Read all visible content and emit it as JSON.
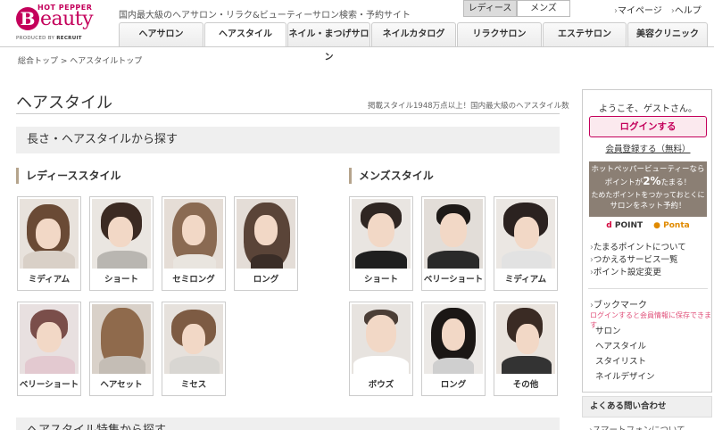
{
  "header": {
    "logo_top": "HOT PEPPER",
    "logo_b": "B",
    "logo_rest": "eauty",
    "logo_produced": "PRODUCED BY",
    "logo_recruit": "RECRUIT",
    "tagline": "国内最大級のヘアサロン・リラク&ビューティーサロン検索・予約サイト",
    "gender_tabs": [
      "レディース",
      "メンズ"
    ],
    "links": [
      "マイページ",
      "ヘルプ"
    ]
  },
  "nav": [
    "ヘアサロン",
    "ヘアスタイル",
    "ネイル・まつげサロン",
    "ネイルカタログ",
    "リラクサロン",
    "エステサロン",
    "美容クリニック"
  ],
  "breadcrumb": "総合トップ  >  ヘアスタイルトップ",
  "main": {
    "title": "ヘアスタイル",
    "subtitle": "掲載スタイル1948万点以上！国内最大級のヘアスタイル数",
    "section1": "長さ・ヘアスタイルから探す",
    "section2": "ヘアスタイル特集から探す",
    "ladies_heading": "レディーススタイル",
    "mens_heading": "メンズスタイル",
    "ladies": [
      "ミディアム",
      "ショート",
      "セミロング",
      "ロング",
      "ベリーショート",
      "ヘアセット",
      "ミセス"
    ],
    "mens": [
      "ショート",
      "ベリーショート",
      "ミディアム",
      "ボウズ",
      "ロング",
      "その他"
    ]
  },
  "sidebar": {
    "welcome": "ようこそ、ゲストさん。",
    "login": "ログインする",
    "register": "会員登録する（無料）",
    "promo_1": "ホットペッパービューティーなら",
    "promo_2a": "ポイントが",
    "promo_2b": "2%",
    "promo_2c": "たまる！",
    "promo_3": "ためたポイントをつかっておとくに",
    "promo_4": "サロンをネット予約！",
    "dpoint_d": "d",
    "dpoint_text": "POINT",
    "ponta": "Ponta",
    "links": [
      "たまるポイントについて",
      "つかえるサービス一覧",
      "ポイント設定変更"
    ],
    "bookmark_title": "ブックマーク",
    "bookmark_note": "ログインすると会員情報に保存できます",
    "bookmark_items": [
      "サロン",
      "ヘアスタイル",
      "スタイリスト",
      "ネイルデザイン"
    ],
    "faq_title": "よくある問い合わせ",
    "faq_item": "スマートフォンについて"
  },
  "colors": {
    "brand": "#c4005b",
    "section_bg": "#efefef",
    "accent_bar": "#b5a48c"
  }
}
